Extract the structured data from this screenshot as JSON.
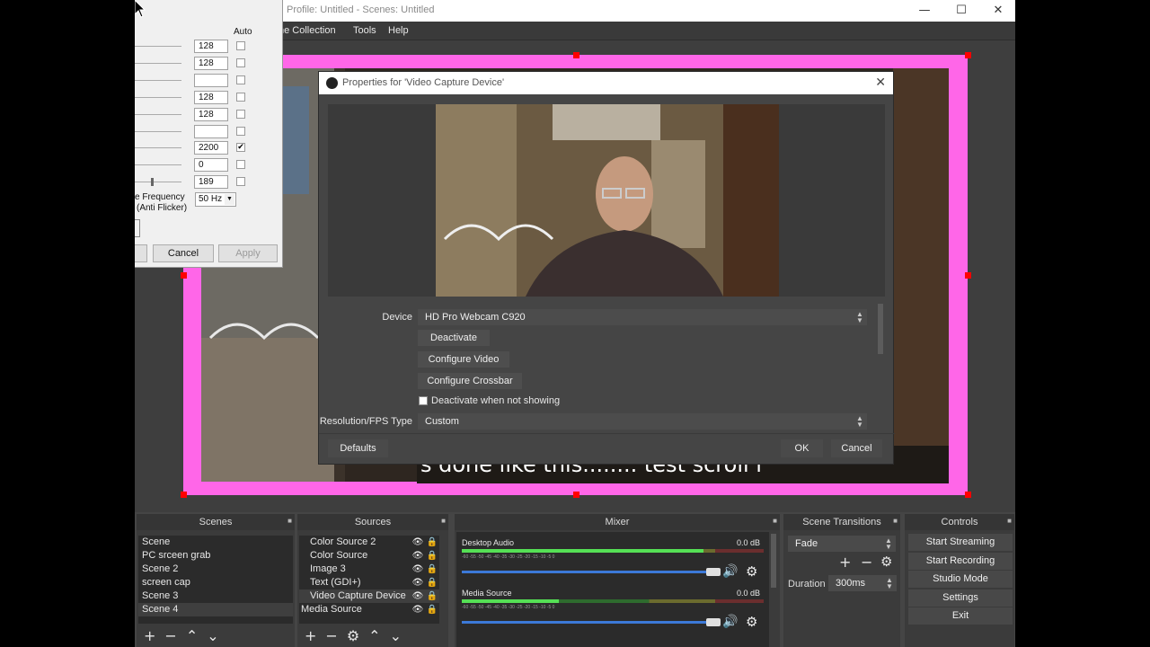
{
  "window": {
    "title": "Profile: Untitled - Scenes: Untitled",
    "minimize_icon": "minimize-icon",
    "maximize_icon": "maximize-icon",
    "close_icon": "close-icon"
  },
  "menu": {
    "items": [
      "ne Collection",
      "Tools",
      "Help"
    ]
  },
  "preview": {
    "caption": "s done like this........ test scroll i"
  },
  "docks": {
    "scenes": {
      "title": "Scenes",
      "items": [
        "Scene",
        "PC srceen grab",
        "Scene 2",
        "screen cap",
        "Scene 3",
        "Scene 4"
      ],
      "selected": "Scene 4"
    },
    "sources": {
      "title": "Sources",
      "items": [
        "Color Source 2",
        "Color Source",
        "Image 3",
        "Text (GDI+)",
        "Video Capture Device",
        "Media Source"
      ]
    },
    "mixer": {
      "title": "Mixer",
      "channels": [
        {
          "name": "Desktop Audio",
          "db": "0.0 dB",
          "level": 1.0,
          "volume": 1.0
        },
        {
          "name": "Media Source",
          "db": "0.0 dB",
          "level": 0.4,
          "volume": 1.0
        }
      ],
      "ticks": "-60 -55 -50 -45 -40 -35 -30 -25 -20 -15 -10 -5 0"
    },
    "transitions": {
      "title": "Scene Transitions",
      "selected": "Fade",
      "duration_label": "Duration",
      "duration_value": "300ms"
    },
    "controls": {
      "title": "Controls",
      "buttons": [
        "Start Streaming",
        "Start Recording",
        "Studio Mode",
        "Settings",
        "Exit"
      ]
    }
  },
  "properties": {
    "title": "Properties for 'Video Capture Device'",
    "device_label": "Device",
    "device_value": "HD Pro Webcam C920",
    "deactivate": "Deactivate",
    "configure_video": "Configure Video",
    "configure_crossbar": "Configure Crossbar",
    "deactivate_when_hidden": "Deactivate when not showing",
    "deactivate_checked": false,
    "resfps_label": "Resolution/FPS Type",
    "resfps_value": "Custom",
    "defaults": "Defaults",
    "ok": "OK",
    "cancel": "Cancel"
  },
  "camera_dialog": {
    "auto_header": "Auto",
    "rows": [
      {
        "value": "128",
        "auto": false
      },
      {
        "value": "128",
        "auto": false
      },
      {
        "value": "",
        "auto": false
      },
      {
        "value": "128",
        "auto": false
      },
      {
        "value": "128",
        "auto": false
      },
      {
        "value": "",
        "auto": false
      },
      {
        "value": "2200",
        "auto": true
      },
      {
        "value": "0",
        "auto": false
      },
      {
        "value": "189",
        "auto": false
      }
    ],
    "freq_label_1": "e Frequency",
    "freq_label_2": "(Anti Flicker)",
    "freq_value": "50 Hz",
    "cancel": "Cancel",
    "apply": "Apply"
  },
  "colors": {
    "canvas_border": "#ff66e8",
    "handle": "#ff0000",
    "accent_blue": "#3c79d8"
  }
}
